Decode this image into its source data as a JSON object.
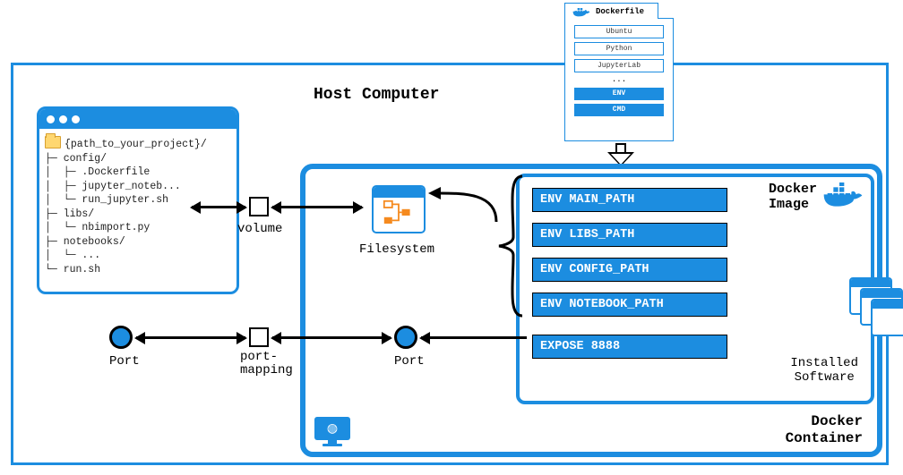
{
  "host_label": "Host Computer",
  "dockerfile": {
    "title": "Dockerfile",
    "rows": [
      "Ubuntu",
      "Python",
      "JupyterLab"
    ],
    "dots": "...",
    "filled": [
      "ENV",
      "CMD"
    ]
  },
  "container_label_l1": "Docker",
  "container_label_l2": "Container",
  "image_label_l1": "Docker",
  "image_label_l2": "Image",
  "env": {
    "r1": "ENV MAIN_PATH",
    "r2": "ENV LIBS_PATH",
    "r3": "ENV CONFIG_PATH",
    "r4": "ENV NOTEBOOK_PATH"
  },
  "expose": "EXPOSE 8888",
  "sw_label_l1": "Installed",
  "sw_label_l2": "Software",
  "filesystem_label": "Filesystem",
  "host_tree": {
    "root": "{path_to_your_project}/",
    "l1": "├─ config/",
    "l1a": "│  ├─ .Dockerfile",
    "l1b": "│  ├─ jupyter_noteb...",
    "l1c": "│  └─ run_jupyter.sh",
    "l2": "├─ libs/",
    "l2a": "│  └─ nbimport.py",
    "l3": "├─ notebooks/",
    "l3a": "│  └─ ...",
    "l4": "└─ run.sh"
  },
  "volume_label": "volume",
  "port_label": "Port",
  "port_mapping_l1": "port-",
  "port_mapping_l2": "mapping"
}
